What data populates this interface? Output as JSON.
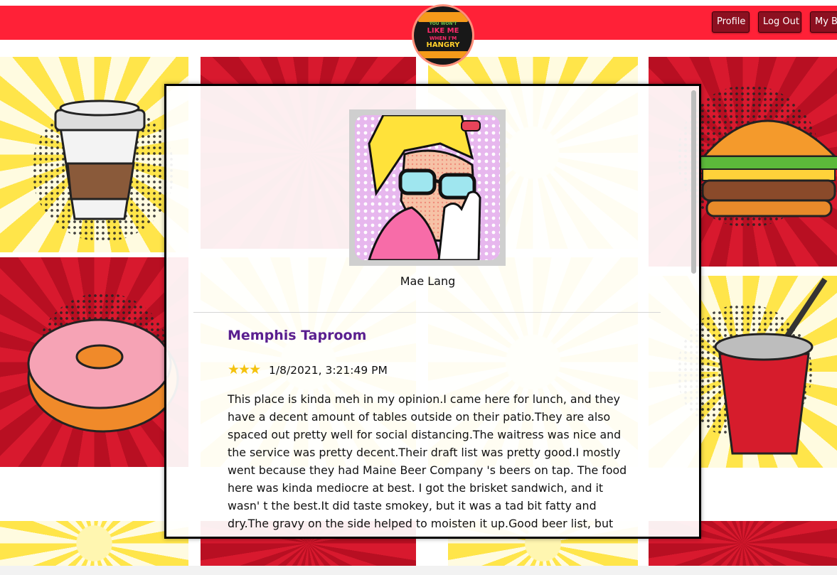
{
  "nav": {
    "profile": "Profile",
    "logout": "Log Out",
    "my_b": "My B"
  },
  "logo": {
    "line1": "YOU WON'T",
    "line2": "LIKE ME",
    "line3": "WHEN I'M",
    "line4": "HANGRY"
  },
  "modal": {
    "user_name": "Mae Lang",
    "restaurant": "Memphis Taproom",
    "stars": "★★★",
    "rating": 3,
    "date": "1/8/2021, 3:21:49 PM",
    "review": "This place is kinda meh in my opinion.I came here for lunch, and they have a decent amount of tables outside on their patio.They are also spaced out pretty well for social distancing.The waitress was nice and the service was pretty decent.Their draft list was pretty good.I mostly went because they had Maine Beer Company 's beers on tap. The food here was kinda mediocre at best. I got the brisket sandwich, and it wasn' t the best.It did taste smokey, but it was a tad bit fatty and dry.The gravy on the side helped to moisten it up.Good beer list, but"
  },
  "colors": {
    "topbar": "#ff2137",
    "restaurant": "#5a1f8f",
    "star": "#f4c20d"
  }
}
